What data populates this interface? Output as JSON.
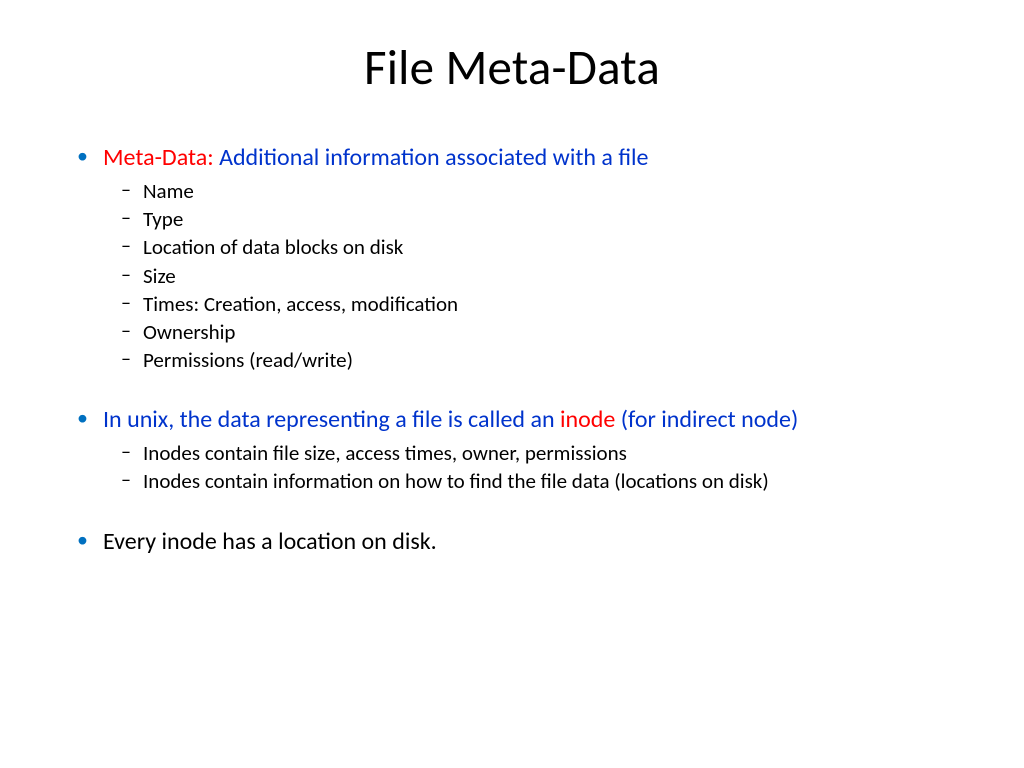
{
  "title": "File Meta-Data",
  "bullets": {
    "b1": {
      "label_red": "Meta-Data: ",
      "label_blue": "Additional information associated with a file",
      "subs": [
        "Name",
        "Type",
        "Location of data blocks on disk",
        "Size",
        "Times: Creation, access, modification",
        "Ownership",
        "Permissions (read/write)"
      ]
    },
    "b2": {
      "part1_blue": "In unix, the data representing a file is called an ",
      "part2_red": "inode",
      "part3_blue": " (for indirect node)",
      "subs": [
        "Inodes contain file size, access times, owner, permissions",
        "Inodes contain information on how to find the file data (locations on disk)"
      ]
    },
    "b3": {
      "text": "Every inode has a location on disk."
    }
  }
}
